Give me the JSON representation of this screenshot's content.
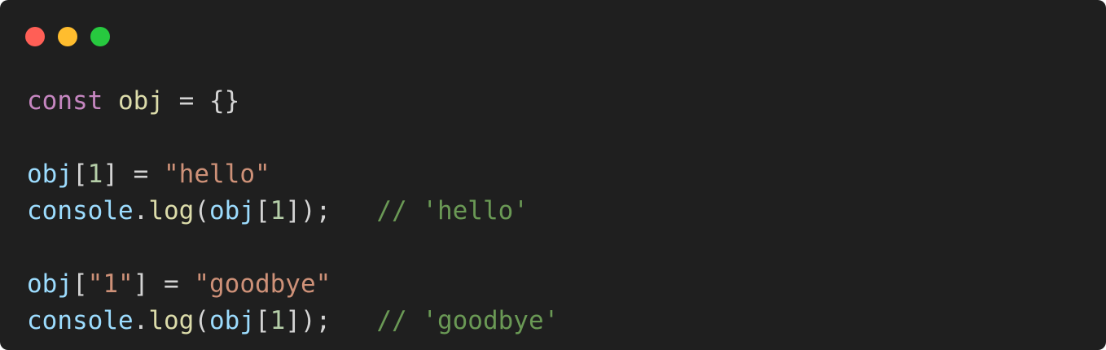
{
  "window": {
    "traffic_lights": [
      {
        "name": "close",
        "color": "#ff5f56"
      },
      {
        "name": "minimize",
        "color": "#ffbd2e"
      },
      {
        "name": "maximize",
        "color": "#27c93f"
      }
    ]
  },
  "code": {
    "lines": [
      [
        {
          "text": "const",
          "kind": "keyword"
        },
        {
          "text": " ",
          "kind": "punct"
        },
        {
          "text": "obj",
          "kind": "const"
        },
        {
          "text": " = {}",
          "kind": "punct"
        }
      ],
      [],
      [
        {
          "text": "obj",
          "kind": "var"
        },
        {
          "text": "[",
          "kind": "punct"
        },
        {
          "text": "1",
          "kind": "number"
        },
        {
          "text": "] = ",
          "kind": "punct"
        },
        {
          "text": "\"hello\"",
          "kind": "string"
        }
      ],
      [
        {
          "text": "console",
          "kind": "var"
        },
        {
          "text": ".",
          "kind": "punct"
        },
        {
          "text": "log",
          "kind": "func"
        },
        {
          "text": "(",
          "kind": "punct"
        },
        {
          "text": "obj",
          "kind": "var"
        },
        {
          "text": "[",
          "kind": "punct"
        },
        {
          "text": "1",
          "kind": "number"
        },
        {
          "text": "]);   ",
          "kind": "punct"
        },
        {
          "text": "// 'hello'",
          "kind": "comment"
        }
      ],
      [],
      [
        {
          "text": "obj",
          "kind": "var"
        },
        {
          "text": "[",
          "kind": "punct"
        },
        {
          "text": "\"1\"",
          "kind": "string"
        },
        {
          "text": "] = ",
          "kind": "punct"
        },
        {
          "text": "\"goodbye\"",
          "kind": "string"
        }
      ],
      [
        {
          "text": "console",
          "kind": "var"
        },
        {
          "text": ".",
          "kind": "punct"
        },
        {
          "text": "log",
          "kind": "func"
        },
        {
          "text": "(",
          "kind": "punct"
        },
        {
          "text": "obj",
          "kind": "var"
        },
        {
          "text": "[",
          "kind": "punct"
        },
        {
          "text": "1",
          "kind": "number"
        },
        {
          "text": "]);   ",
          "kind": "punct"
        },
        {
          "text": "// 'goodbye'",
          "kind": "comment"
        }
      ]
    ]
  }
}
